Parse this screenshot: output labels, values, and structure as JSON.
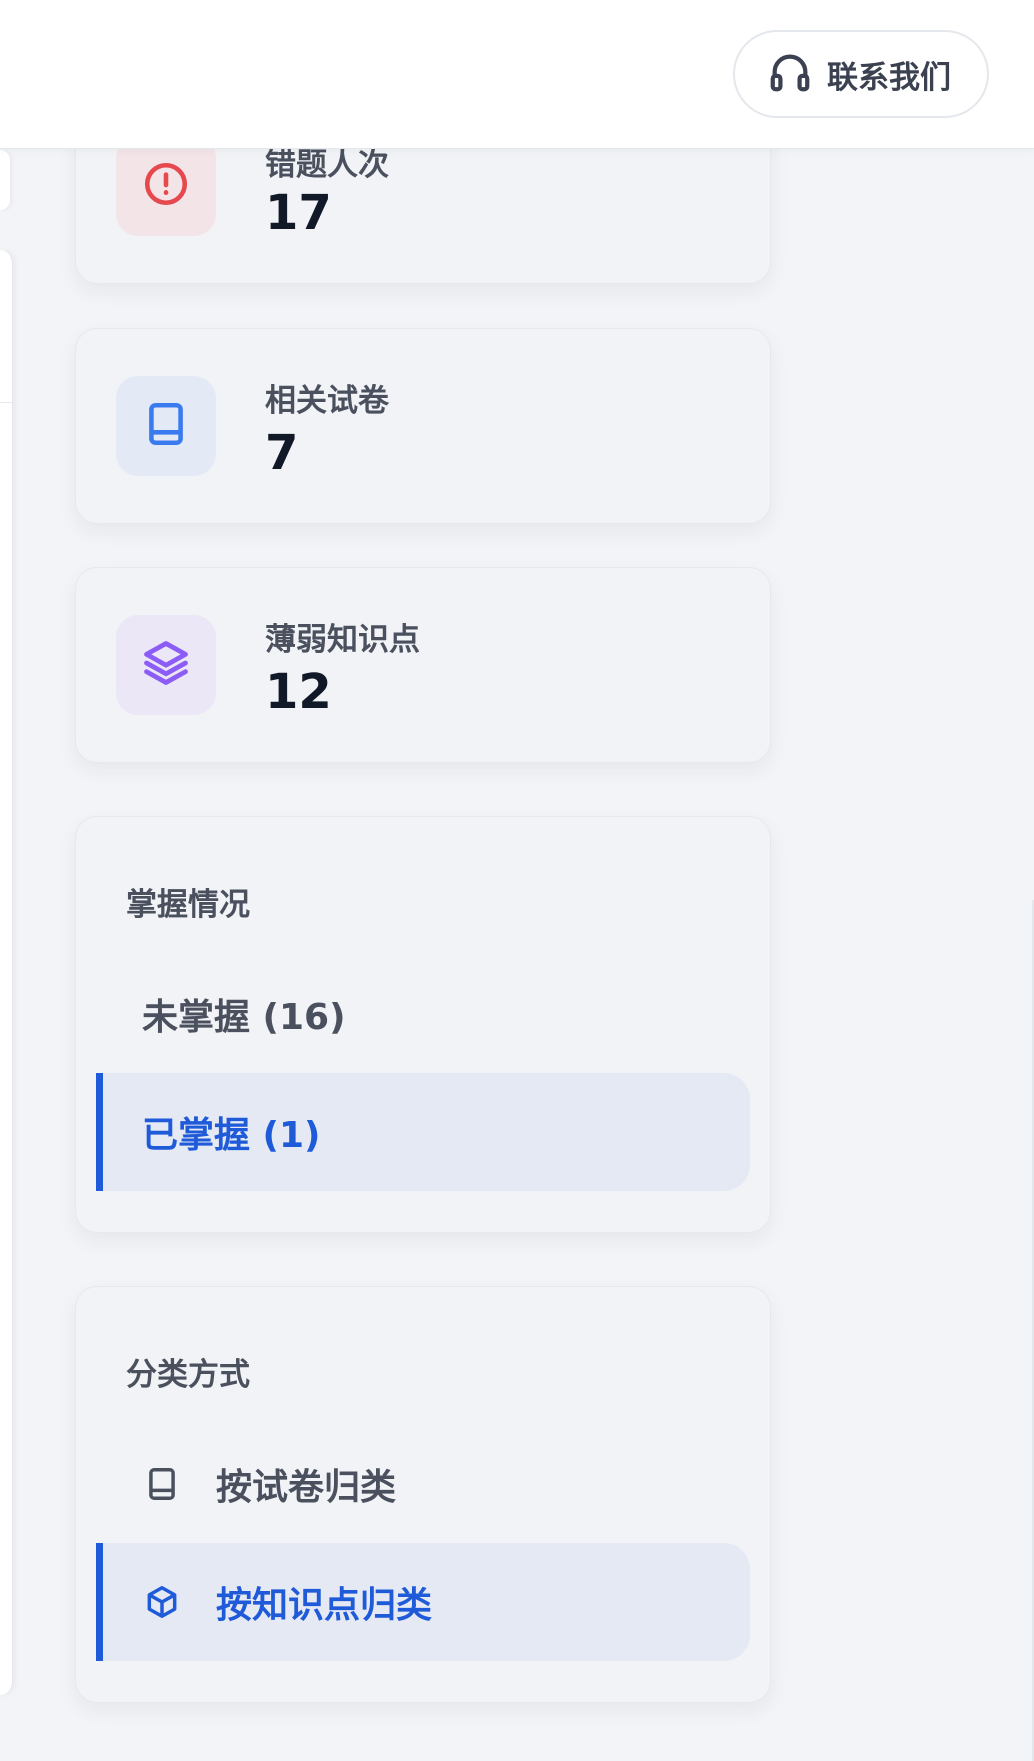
{
  "header": {
    "contact_label": "联系我们",
    "contact_icon": "headphones-icon"
  },
  "stats": [
    {
      "label": "错题人次",
      "value": "17",
      "icon": "alert-circle-icon",
      "icon_color": "#e5484d",
      "icon_bg": "#f3e4e7"
    },
    {
      "label": "相关试卷",
      "value": "7",
      "icon": "book-icon",
      "icon_color": "#3b7bf0",
      "icon_bg": "#e4eaf5"
    },
    {
      "label": "薄弱知识点",
      "value": "12",
      "icon": "layers-icon",
      "icon_color": "#8b5cf6",
      "icon_bg": "#ebe7f6"
    }
  ],
  "mastery": {
    "title": "掌握情况",
    "options": [
      {
        "label": "未掌握 (16)",
        "active": false
      },
      {
        "label": "已掌握 (1)",
        "active": true
      }
    ]
  },
  "classify": {
    "title": "分类方式",
    "options": [
      {
        "label": "按试卷归类",
        "icon": "book-icon",
        "active": false
      },
      {
        "label": "按知识点归类",
        "icon": "cube-icon",
        "active": true
      }
    ]
  },
  "colors": {
    "accent": "#1f5ad9",
    "active_bg": "#e5e9f4",
    "card_bg": "#f1f3f6",
    "page_bg": "#f2f4f7"
  }
}
